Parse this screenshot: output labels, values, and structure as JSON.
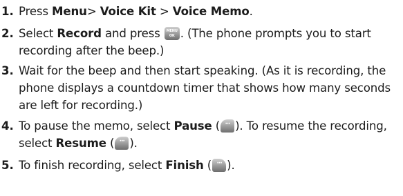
{
  "steps": [
    {
      "num": "1.",
      "parts": [
        "Press ",
        "Menu",
        "> ",
        "Voice Kit",
        " > ",
        "Voice Memo",
        "."
      ]
    },
    {
      "num": "2.",
      "parts": [
        "Select ",
        "Record",
        " and press ",
        ". (The phone prompts you to start recording after the beep.)"
      ]
    },
    {
      "num": "3.",
      "text": "Wait for the beep and then start speaking. (As it is recording, the phone displays a countdown timer that shows how many seconds are left for recording.)"
    },
    {
      "num": "4.",
      "parts": [
        "To pause the memo, select ",
        "Pause",
        " (",
        "). To resume the recording, select ",
        "Resume",
        " (",
        ")."
      ]
    },
    {
      "num": "5.",
      "parts": [
        "To finish recording, select ",
        "Finish",
        " (",
        ")."
      ]
    }
  ],
  "keys": {
    "menu_ok": {
      "icon": "menu-ok-key-icon",
      "line1": "MENU",
      "line2": "OK"
    },
    "softkey": {
      "icon": "softkey-icon",
      "glyph": "···"
    }
  },
  "colors": {
    "text": "#1c1c1c",
    "key_top": "#cfcfcf",
    "key_bottom": "#6e6e6e"
  }
}
